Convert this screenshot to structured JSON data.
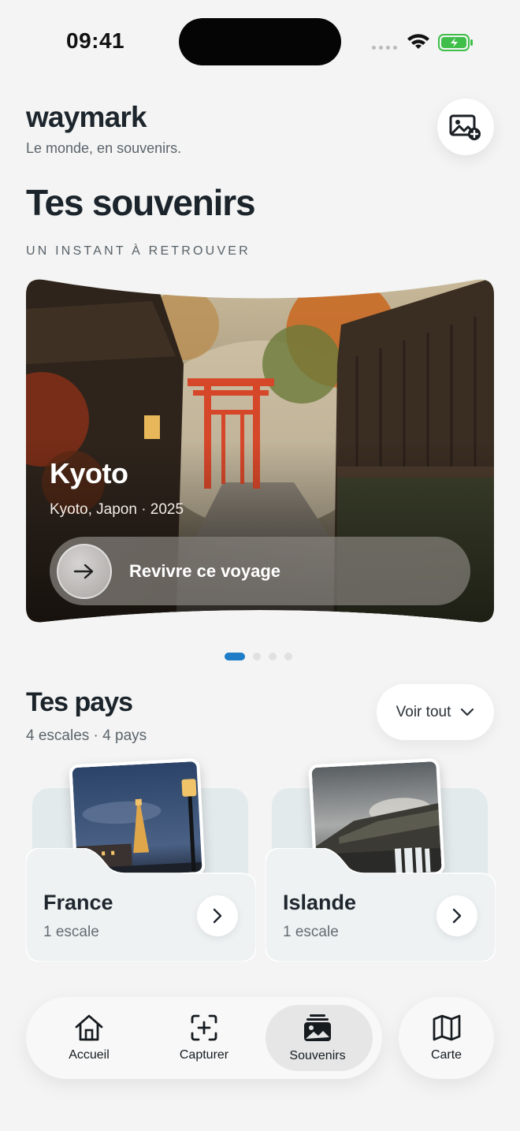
{
  "status": {
    "time": "09:41"
  },
  "header": {
    "brand": "waymark",
    "tagline": "Le monde, en souvenirs.",
    "add_photo_icon": "photo-add-icon"
  },
  "page": {
    "title": "Tes souvenirs",
    "eyebrow": "UN INSTANT À RETROUVER"
  },
  "featured": {
    "title": "Kyoto",
    "subtitle": "Kyoto, Japon · 2025",
    "cta": "Revivre ce voyage",
    "carousel_total": 4,
    "carousel_active": 1
  },
  "countries": {
    "title": "Tes pays",
    "subtitle": "4 escales · 4 pays",
    "see_all": "Voir tout",
    "items": [
      {
        "name": "France",
        "stops": "1 escale"
      },
      {
        "name": "Islande",
        "stops": "1 escale"
      }
    ]
  },
  "tabs": {
    "items": [
      {
        "label": "Accueil",
        "icon": "home-icon"
      },
      {
        "label": "Capturer",
        "icon": "capture-icon"
      },
      {
        "label": "Souvenirs",
        "icon": "photo-stack-icon",
        "active": true
      }
    ],
    "map": {
      "label": "Carte",
      "icon": "map-icon"
    }
  },
  "colors": {
    "accent": "#1f7cc6",
    "background": "#f3f4f3",
    "torii": "#d6472a"
  }
}
